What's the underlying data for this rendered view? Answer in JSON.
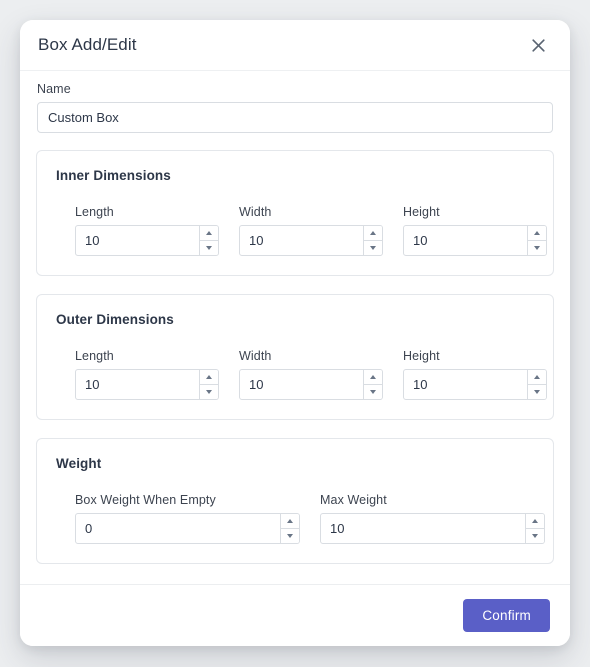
{
  "modal": {
    "title": "Box Add/Edit",
    "close_icon": "close-icon",
    "name_field": {
      "label": "Name",
      "value": "Custom Box",
      "placeholder": "Name"
    },
    "sections": [
      {
        "title": "Inner Dimensions",
        "fields": [
          {
            "label": "Length",
            "value": "10"
          },
          {
            "label": "Width",
            "value": "10"
          },
          {
            "label": "Height",
            "value": "10"
          }
        ]
      },
      {
        "title": "Outer Dimensions",
        "fields": [
          {
            "label": "Length",
            "value": "10"
          },
          {
            "label": "Width",
            "value": "10"
          },
          {
            "label": "Height",
            "value": "10"
          }
        ]
      },
      {
        "title": "Weight",
        "fields": [
          {
            "label": "Box Weight When Empty",
            "value": "0"
          },
          {
            "label": "Max Weight",
            "value": "10"
          }
        ]
      }
    ],
    "footer": {
      "confirm_label": "Confirm"
    }
  },
  "colors": {
    "accent": "#5a5fc7",
    "page_background": "#eceef0",
    "surface": "#ffffff",
    "border": "#d9dde2",
    "text": "#2d3748"
  }
}
